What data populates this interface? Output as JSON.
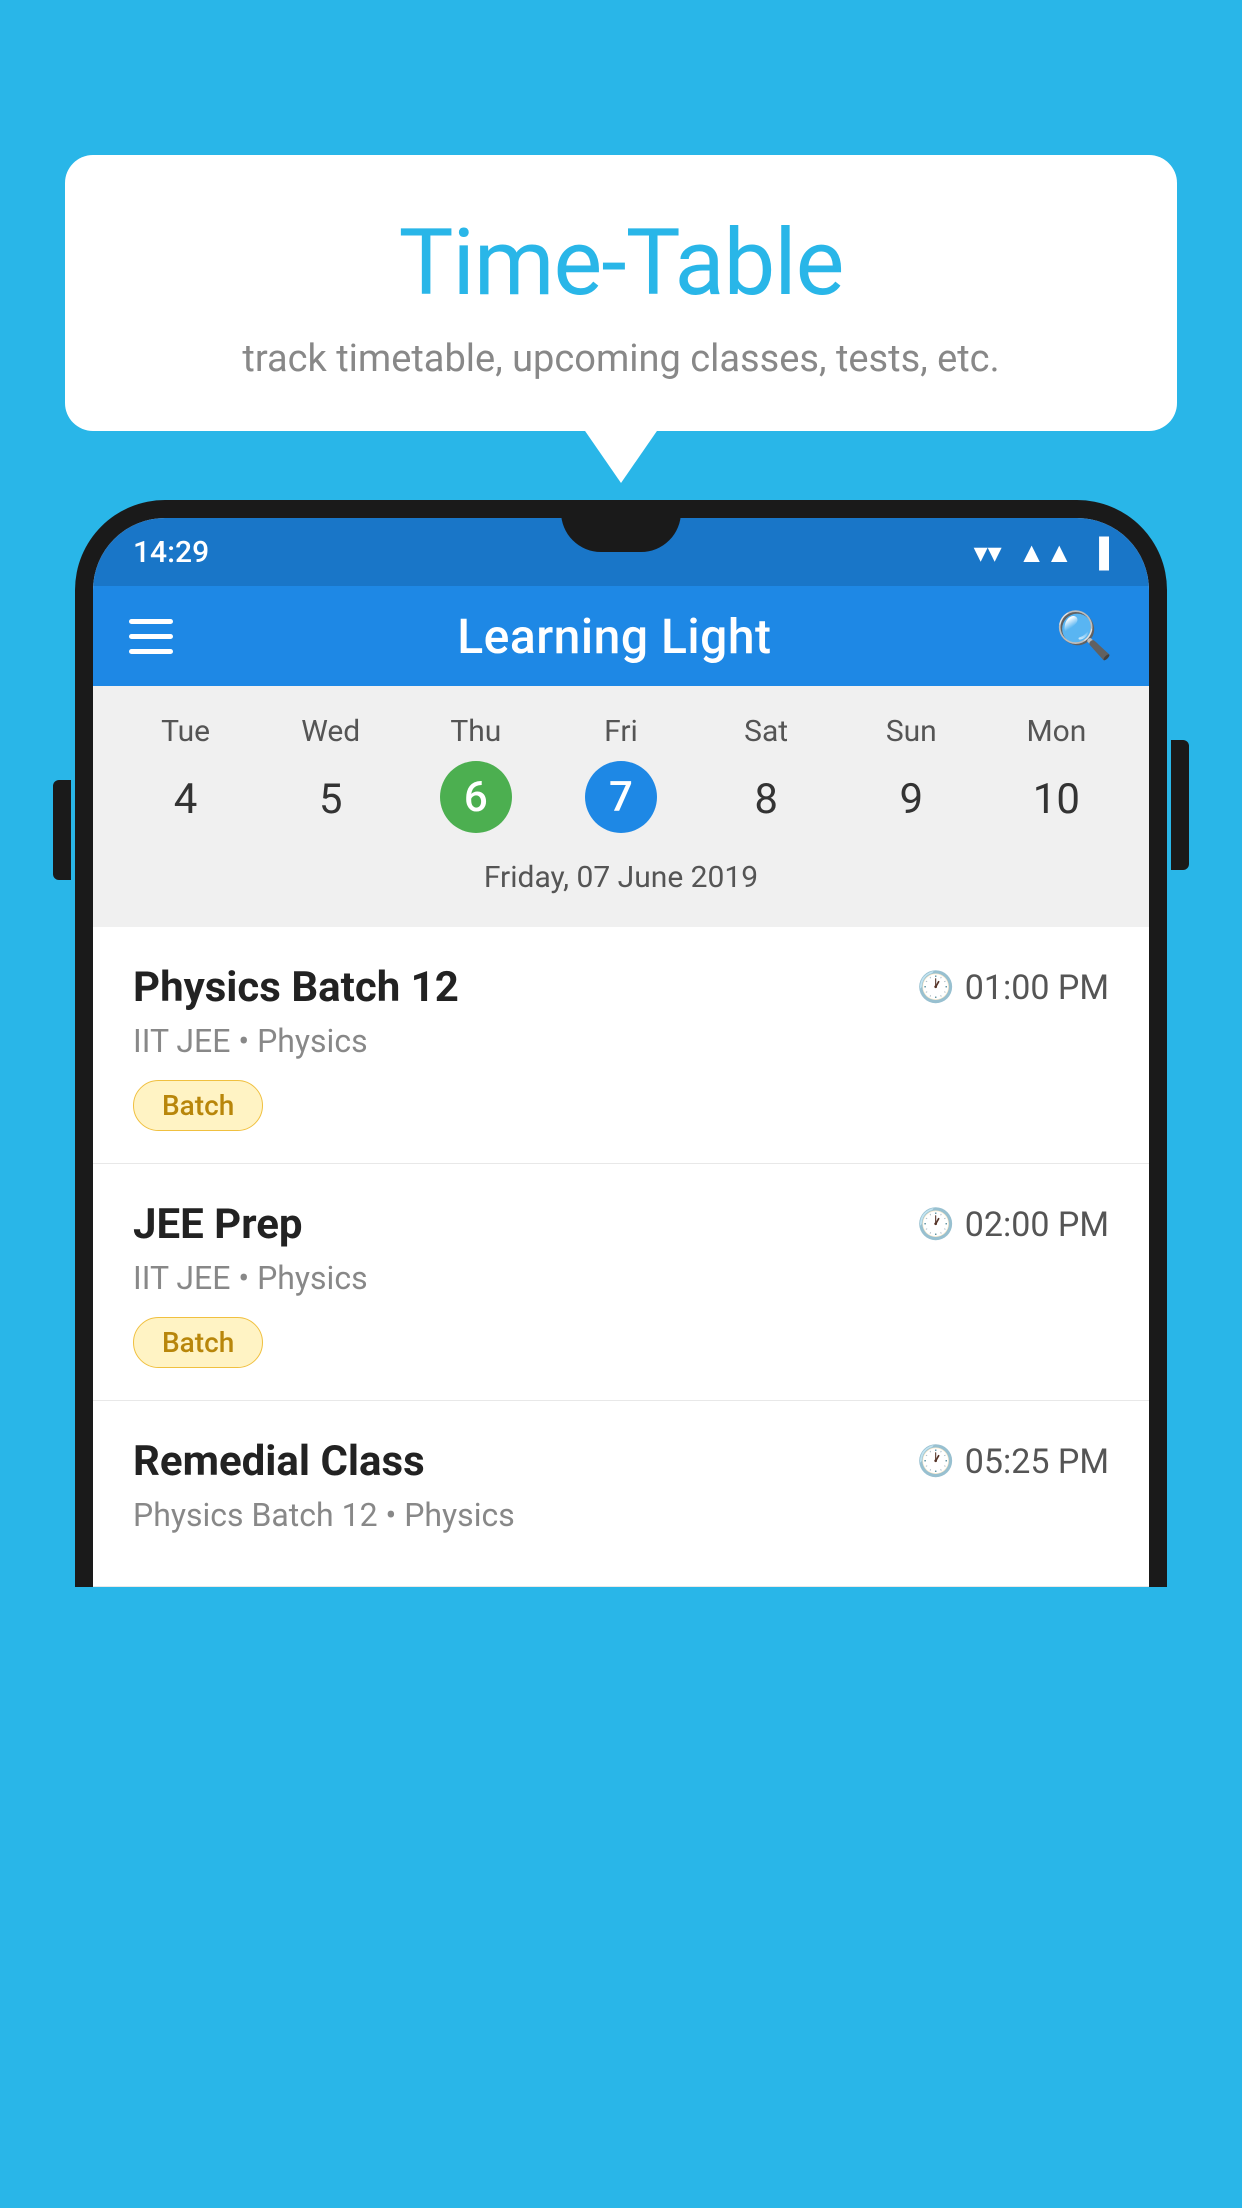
{
  "background_color": "#29b6e8",
  "speech_bubble": {
    "title": "Time-Table",
    "subtitle": "track timetable, upcoming classes, tests, etc."
  },
  "status_bar": {
    "time": "14:29",
    "wifi": "▼",
    "signal": "▲",
    "battery": "▐"
  },
  "app_bar": {
    "title": "Learning Light",
    "menu_label": "menu",
    "search_label": "search"
  },
  "calendar": {
    "days": [
      {
        "label": "Tue",
        "num": "4",
        "state": "normal"
      },
      {
        "label": "Wed",
        "num": "5",
        "state": "normal"
      },
      {
        "label": "Thu",
        "num": "6",
        "state": "today"
      },
      {
        "label": "Fri",
        "num": "7",
        "state": "selected"
      },
      {
        "label": "Sat",
        "num": "8",
        "state": "normal"
      },
      {
        "label": "Sun",
        "num": "9",
        "state": "normal"
      },
      {
        "label": "Mon",
        "num": "10",
        "state": "normal"
      }
    ],
    "selected_date_label": "Friday, 07 June 2019"
  },
  "schedule_items": [
    {
      "title": "Physics Batch 12",
      "time": "01:00 PM",
      "subtitle": "IIT JEE • Physics",
      "tag": "Batch"
    },
    {
      "title": "JEE Prep",
      "time": "02:00 PM",
      "subtitle": "IIT JEE • Physics",
      "tag": "Batch"
    },
    {
      "title": "Remedial Class",
      "time": "05:25 PM",
      "subtitle": "Physics Batch 12 • Physics",
      "tag": ""
    }
  ]
}
